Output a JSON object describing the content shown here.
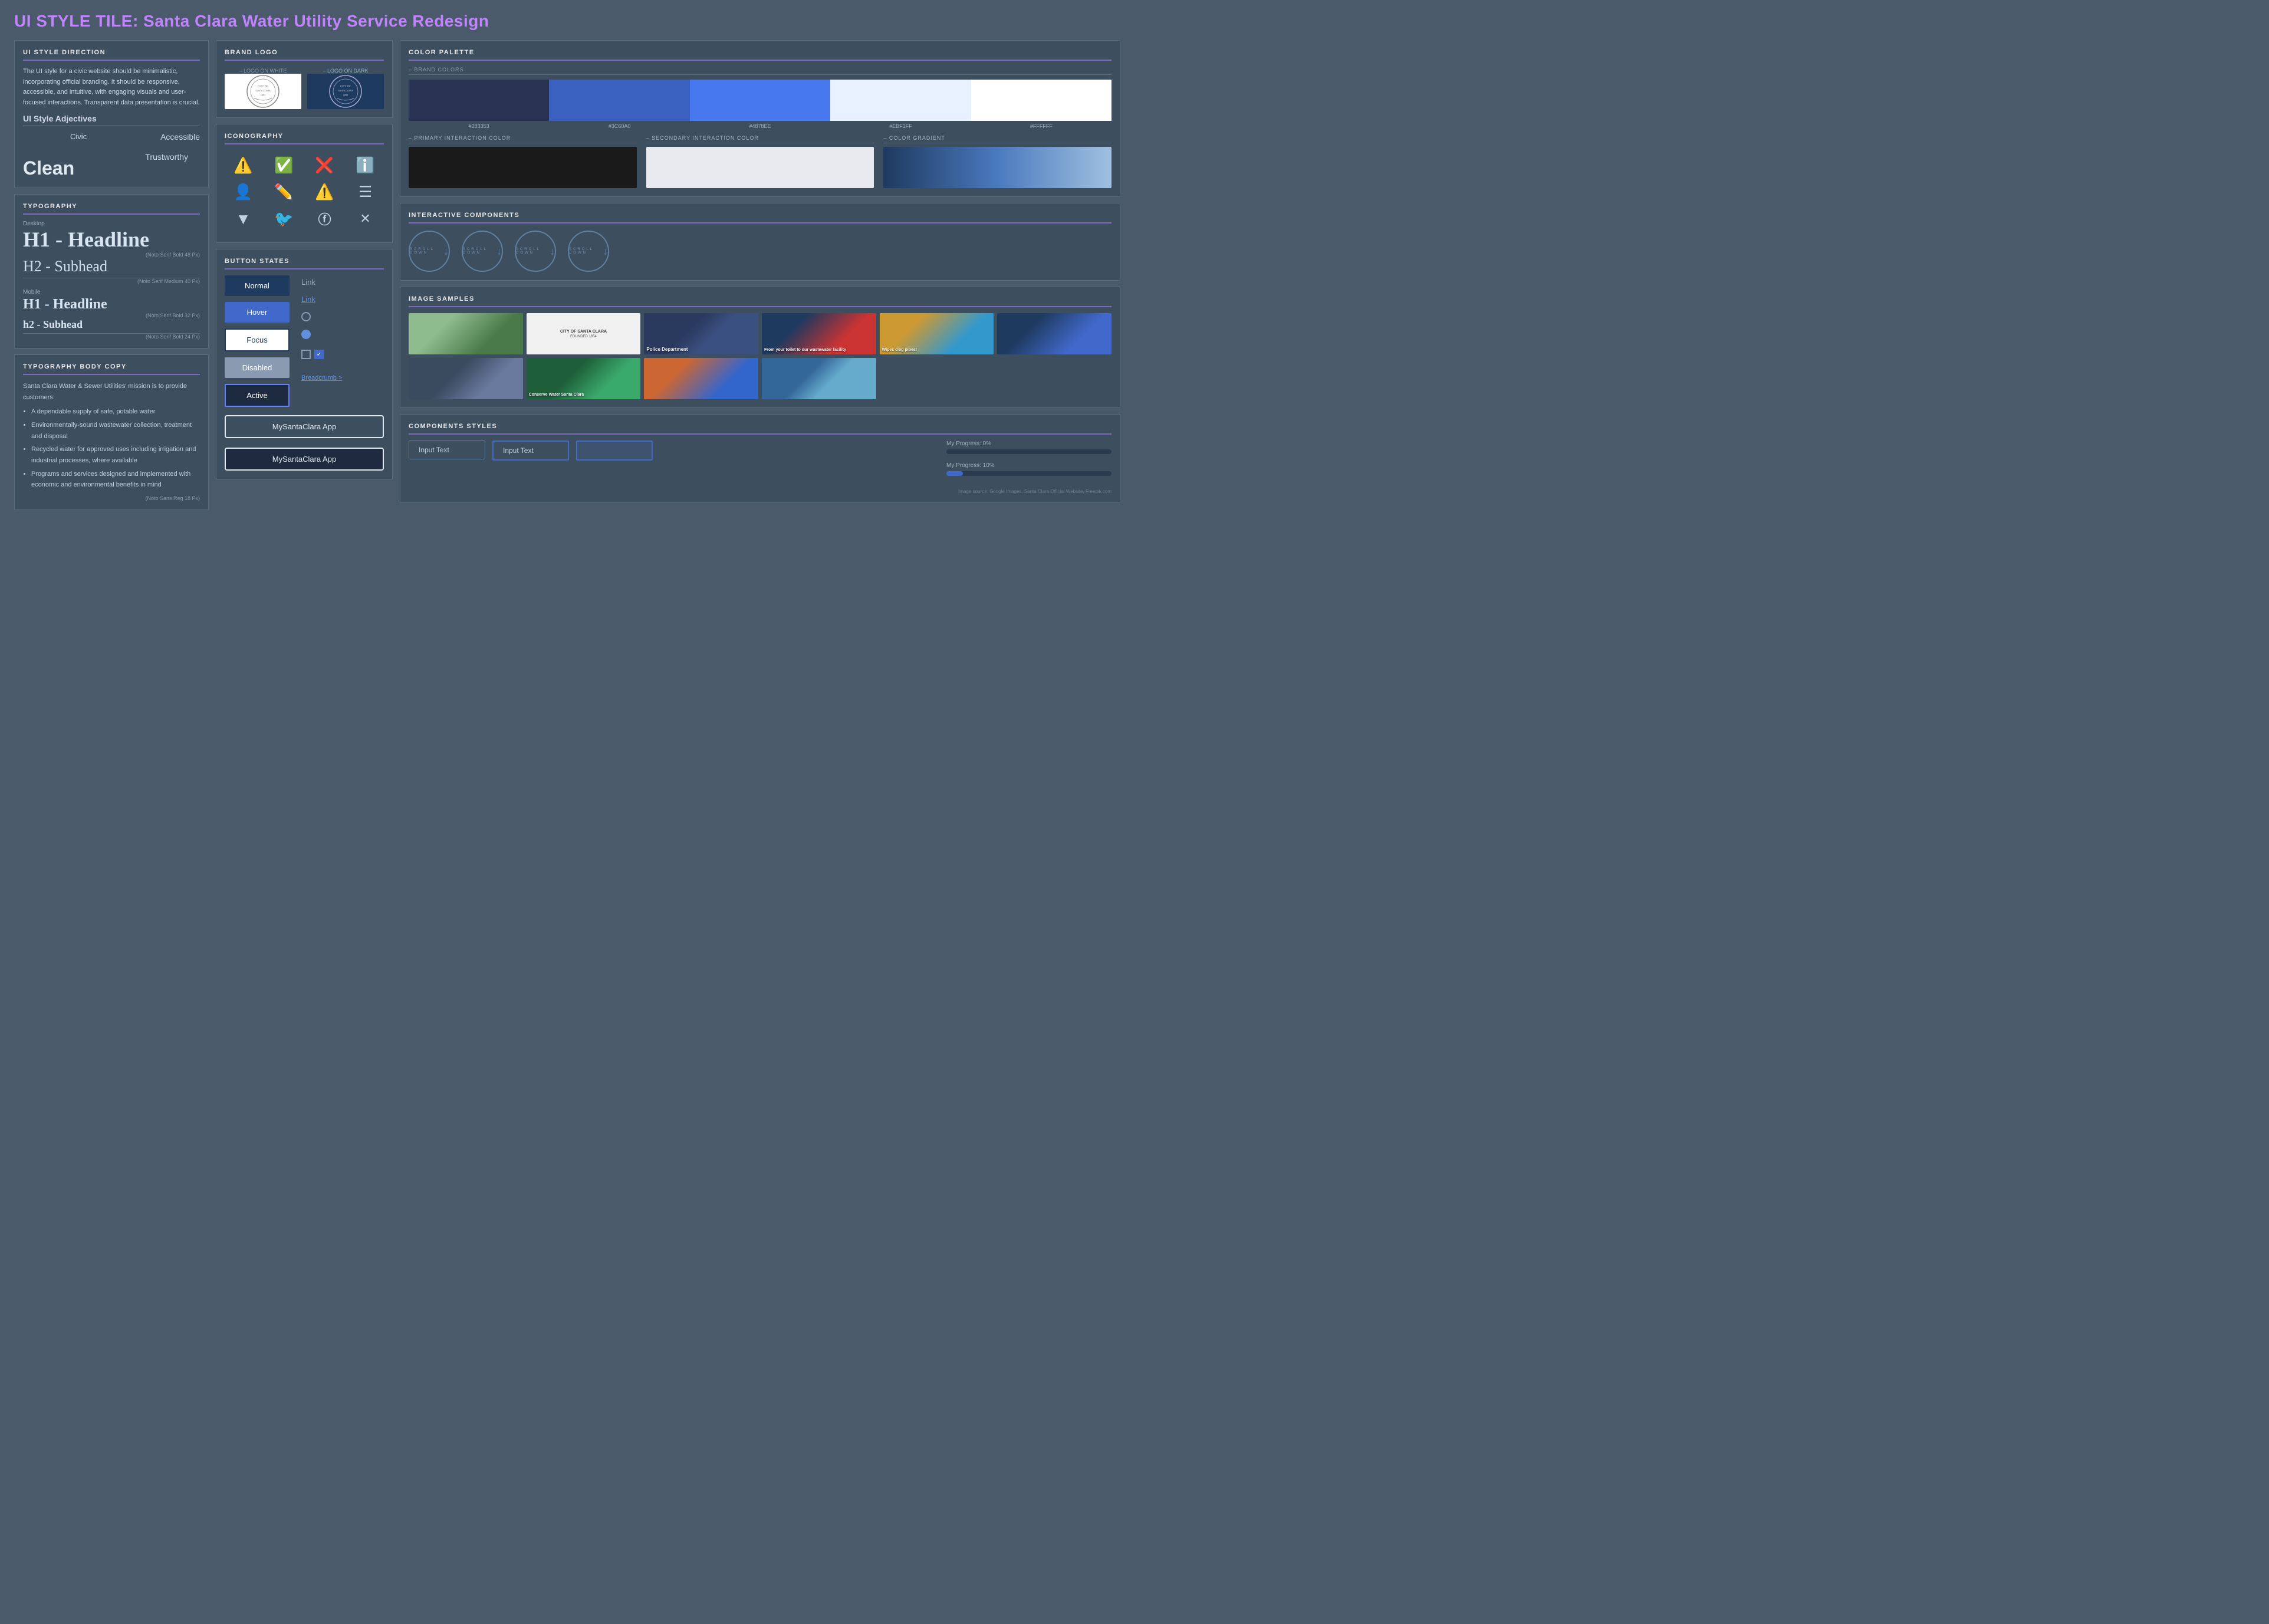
{
  "page": {
    "title": "UI STYLE TILE:",
    "subtitle": " Santa Clara Water Utility Service Redesign",
    "bg_color": "#4a5a6b"
  },
  "left_col": {
    "style_direction": {
      "title": "UI STYLE DIRECTION",
      "body": "The UI style for a civic website should be minimalistic, incorporating official branding. It should be responsive, accessible, and intuitive, with engaging visuals and user-focused interactions. Transparent data presentation is crucial."
    },
    "adjectives": {
      "title": "UI Style Adjectives",
      "words": [
        "Clean",
        "Civic",
        "Accessible",
        "Trustworthy"
      ]
    },
    "typography": {
      "title": "TYPOGRAPHY",
      "desktop_label": "Desktop",
      "h1_label": "H1 - Headline",
      "h1_note": "(Noto Serif Bold 48 Px)",
      "h2_label": "H2 - Subhead",
      "h2_note": "(Noto Serif Medium 40 Px)",
      "mobile_label": "Mobile",
      "h1_mobile_label": "H1 - Headline",
      "h1_mobile_note": "(Noto Serif Bold 32 Px)",
      "h2_mobile_label": "h2 - Subhead",
      "h2_mobile_note": "(Noto Serif Bold 24 Px)"
    },
    "body_copy": {
      "title": "TYPOGRAPHY BODY COPY",
      "intro": "Santa Clara Water & Sewer Utilities' mission is to provide customers:",
      "items": [
        "A dependable supply of safe, potable water",
        "Environmentally-sound wastewater collection, treatment and disposal",
        "Recycled water for approved uses including irrigation and industrial processes, where available",
        "Programs and services designed and implemented with economic and environmental benefits in mind"
      ],
      "note": "(Noto Sans Reg 18 Px)"
    }
  },
  "mid_col": {
    "brand_logo": {
      "title": "BRAND LOGO",
      "label_white": "– LOGO ON WHITE",
      "label_dark": "– LOGO ON DARK"
    },
    "iconography": {
      "title": "ICONOGRAPHY",
      "icons": [
        "⚠",
        "✅",
        "❌",
        "ℹ",
        "👤",
        "✏",
        "⚠",
        "☰",
        "▼",
        "🐦",
        "ⓕ",
        "✕"
      ]
    },
    "button_states": {
      "title": "BUTTON STATES",
      "normal": "Normal",
      "hover": "Hover",
      "focus": "Focus",
      "disabled": "Disabled",
      "active": "Active",
      "link_normal": "Link",
      "link_hover": "Link",
      "breadcrumb": "Breadcrumb >",
      "app_btn1": "MySantaClara App",
      "app_btn2": "MySantaClara App"
    }
  },
  "right_col": {
    "color_palette": {
      "title": "COLOR PALETTE",
      "brand_label": "– BRAND COLORS",
      "colors": [
        {
          "hex": "#283353",
          "label": "#283353"
        },
        {
          "hex": "#3a60c0",
          "label": "#3C60A0"
        },
        {
          "hex": "#4878ee",
          "label": "#4878EE"
        },
        {
          "hex": "#e8f1ff",
          "label": "#EBF1FF"
        },
        {
          "hex": "#ffffff",
          "label": "#FFFFFF"
        }
      ],
      "primary_label": "– PRIMARY INTERACTION COLOR",
      "secondary_label": "– SECONDARY INTERACTION COLOR",
      "gradient_label": "– COLOR GRADIENT",
      "primary_color": "#1a1a1a",
      "secondary_color": "#e8eaf0"
    },
    "interactive_components": {
      "title": "INTERACTIVE COMPONENTS",
      "scroll_items": [
        "SCROLL DOWN",
        "SCROLL DOWN",
        "SCROLL DOWN",
        "SCROLL DOWN"
      ]
    },
    "image_samples": {
      "title": "IMAGE SAMPLES",
      "images": [
        {
          "type": "road",
          "label": ""
        },
        {
          "type": "logo",
          "label": "CITY OF SANTA CLARA"
        },
        {
          "type": "police",
          "label": "Police Department"
        },
        {
          "type": "toilet",
          "label": "From your toilet to our wastewater facility"
        },
        {
          "type": "pipes",
          "label": "Wipes clog pipes!"
        },
        {
          "type": "utility1",
          "label": ""
        },
        {
          "type": "meeting",
          "label": ""
        },
        {
          "type": "conserve",
          "label": "Conserve Water Santa Clara"
        },
        {
          "type": "sunset",
          "label": ""
        },
        {
          "type": "wastewater",
          "label": ""
        }
      ]
    },
    "component_styles": {
      "title": "COMPONENTS STYLES",
      "input1": "Input Text",
      "input2": "Input Text",
      "input3": "",
      "progress1_label": "My Progress:  0%",
      "progress1_value": 0,
      "progress2_label": "My Progress:  10%",
      "progress2_value": 10,
      "image_source": "Image source: Google Images, Santa Clara Official Website, Freepik.com"
    }
  }
}
